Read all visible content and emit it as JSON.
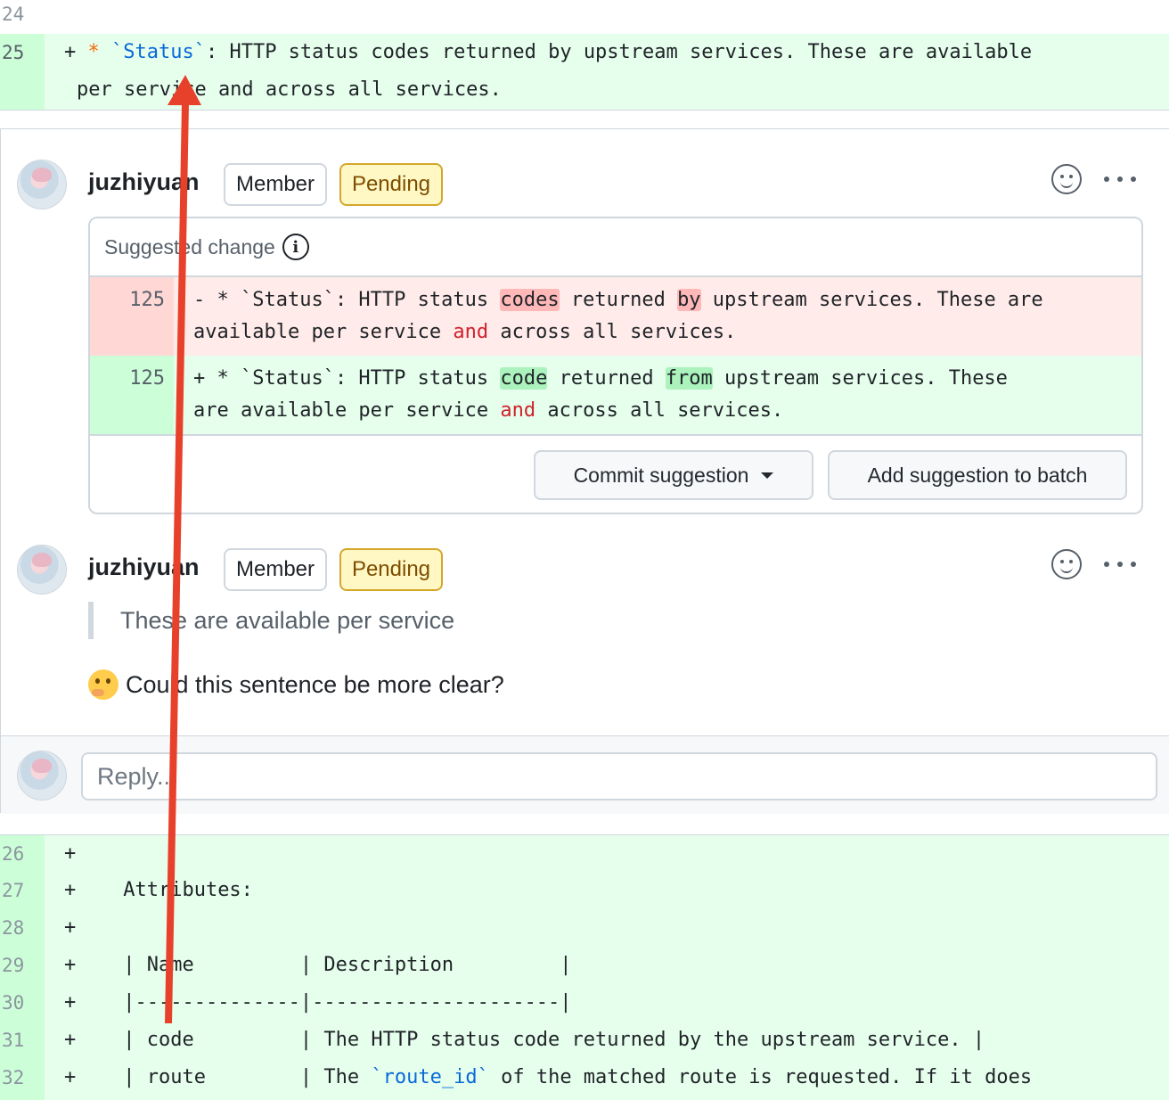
{
  "diff_top": {
    "line_24": {
      "num": "24",
      "text": ""
    },
    "line_25": {
      "num": "25",
      "plus": "+",
      "bullet": "*",
      "code_token": "`Status`",
      "rest": ": HTTP status codes returned by upstream services. These are available",
      "cont": "per service and across all services."
    }
  },
  "comment1": {
    "author": "juzhiyuan",
    "badge_member": "Member",
    "badge_pending": "Pending",
    "suggested_label": "Suggested change",
    "info_icon": "i",
    "del_line": {
      "num": "125",
      "p1": "- * `Status`: HTTP status ",
      "h1": "codes",
      "p2": " returned ",
      "h2": "by",
      "p3": " upstream services. These are",
      "p4": "available per service ",
      "kw": "and",
      "p5": " across all services."
    },
    "add_line": {
      "num": "125",
      "p1": "+ * `Status`: HTTP status ",
      "h1": "code",
      "p2": " returned ",
      "h2": "from",
      "p3": " upstream services. These",
      "p4": "are available per service ",
      "kw": "and",
      "p5": " across all services."
    },
    "commit_button": "Commit suggestion",
    "batch_button": "Add suggestion to batch"
  },
  "comment2": {
    "author": "juzhiyuan",
    "badge_member": "Member",
    "badge_pending": "Pending",
    "quote": "These are available per service",
    "body": "Could this sentence be more clear?"
  },
  "reply": {
    "placeholder": "Reply..."
  },
  "diff_bottom": [
    {
      "num": "26",
      "plus": "+",
      "text": ""
    },
    {
      "num": "27",
      "plus": "+",
      "text": "    Attributes:"
    },
    {
      "num": "28",
      "plus": "+",
      "text": ""
    },
    {
      "num": "29",
      "plus": "+",
      "text": "    | Name         | Description         |"
    },
    {
      "num": "30",
      "plus": "+",
      "text": "    |--------------|---------------------|"
    },
    {
      "num": "31",
      "plus": "+",
      "text": "    | code         | The HTTP status code returned by the upstream service. |"
    },
    {
      "num": "32",
      "plus": "+",
      "pre": "    | route        | The ",
      "code_token": "`route_id`",
      "post": " of the matched route is requested. If it does"
    }
  ],
  "colors": {
    "arrow": "#e8412b",
    "add_bg": "#e6ffec",
    "del_bg": "#ffebe9",
    "link": "#0969da",
    "orange": "#f66a0a"
  },
  "icons": [
    "info-icon",
    "smiley-icon",
    "kebab-icon",
    "caret-down-icon",
    "thinking-face-icon",
    "red-arrow"
  ]
}
